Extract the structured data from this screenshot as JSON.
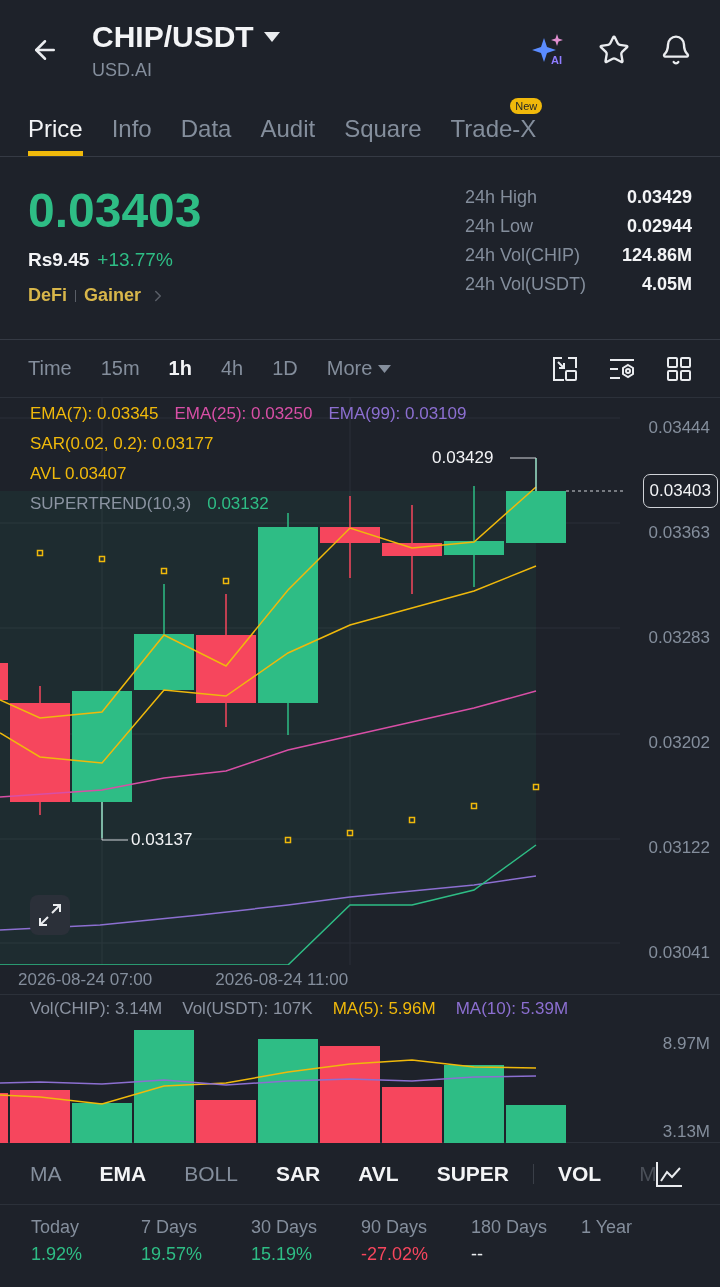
{
  "header": {
    "title": "CHIP/USDT",
    "subtitle": "USD.AI",
    "ai_label": "AI"
  },
  "tabs": [
    {
      "label": "Price",
      "selected": true
    },
    {
      "label": "Info",
      "selected": false
    },
    {
      "label": "Data",
      "selected": false
    },
    {
      "label": "Audit",
      "selected": false
    },
    {
      "label": "Square",
      "selected": false
    },
    {
      "label": "Trade-X",
      "selected": false,
      "badge": "New"
    }
  ],
  "ticker": {
    "last": "0.03403",
    "fiat": "Rs9.45",
    "change": "+13.77%",
    "tags": [
      "DeFi",
      "Gainer"
    ]
  },
  "stats": [
    {
      "label": "24h High",
      "value": "0.03429"
    },
    {
      "label": "24h Low",
      "value": "0.02944"
    },
    {
      "label": "24h Vol(CHIP)",
      "value": "124.86M"
    },
    {
      "label": "24h Vol(USDT)",
      "value": "4.05M"
    }
  ],
  "intervals": [
    {
      "label": "Time",
      "selected": false
    },
    {
      "label": "15m",
      "selected": false
    },
    {
      "label": "1h",
      "selected": true
    },
    {
      "label": "4h",
      "selected": false
    },
    {
      "label": "1D",
      "selected": false
    }
  ],
  "more": "More",
  "legend": [
    [
      {
        "text": "EMA(7): 0.03345",
        "color": "#f0b90b"
      },
      {
        "text": "EMA(25): 0.03250",
        "color": "#d84fa6"
      },
      {
        "text": "EMA(99): 0.03109",
        "color": "#8c6fd1"
      }
    ],
    [
      {
        "text": "SAR(0.02, 0.2): 0.03177",
        "color": "#f0b90b"
      }
    ],
    [
      {
        "text": "AVL 0.03407",
        "color": "#f0b90b"
      }
    ],
    [
      {
        "text": "SUPERTREND(10,3)",
        "color": "#8b93a1"
      },
      {
        "text": "0.03132",
        "color": "#2ebd85"
      }
    ]
  ],
  "price_axis": [
    "0.03444",
    "0.03363",
    "0.03283",
    "0.03202",
    "0.03122",
    "0.03041"
  ],
  "last_price": "0.03403",
  "high_label": "0.03429",
  "low_label": "0.03137",
  "time_labels": [
    "2026-08-24 07:00",
    "2026-08-24 11:00"
  ],
  "volume_legend": [
    {
      "text": "Vol(CHIP): 3.14M",
      "color": "#8b93a1"
    },
    {
      "text": "Vol(USDT): 107K",
      "color": "#8b93a1"
    },
    {
      "text": "MA(5): 5.96M",
      "color": "#f0b90b"
    },
    {
      "text": "MA(10): 5.39M",
      "color": "#8c6fd1"
    }
  ],
  "volume_axis": [
    "8.97M",
    "3.13M"
  ],
  "indicators": [
    {
      "label": "MA",
      "selected": false
    },
    {
      "label": "EMA",
      "selected": true
    },
    {
      "label": "BOLL",
      "selected": false
    },
    {
      "label": "SAR",
      "selected": true
    },
    {
      "label": "AVL",
      "selected": true
    },
    {
      "label": "SUPER",
      "selected": true
    },
    {
      "label": "VOL",
      "selected": true,
      "kind": "sub"
    },
    {
      "label": "M",
      "selected": false,
      "kind": "sub"
    }
  ],
  "performance": [
    {
      "label": "Today",
      "value": "1.92%",
      "color": "#2ebd85"
    },
    {
      "label": "7 Days",
      "value": "19.57%",
      "color": "#2ebd85"
    },
    {
      "label": "30 Days",
      "value": "15.19%",
      "color": "#2ebd85"
    },
    {
      "label": "90 Days",
      "value": "-27.02%",
      "color": "#f6465d"
    },
    {
      "label": "180 Days",
      "value": "--",
      "color": "#eaecef"
    },
    {
      "label": "1 Year"
    }
  ]
}
